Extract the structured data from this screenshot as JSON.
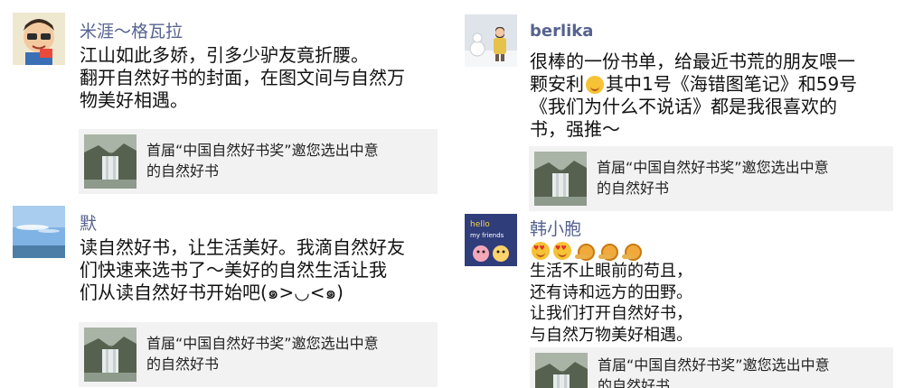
{
  "posts": [
    {
      "author": "米涯～格瓦拉",
      "lines": [
        "江山如此多娇，引多少驴友竟折腰。",
        "翻开自然好书的封面，在图文间与自然万",
        "物美好相遇。"
      ],
      "card": {
        "line1": "首届“中国自然好书奖”邀您选出中意",
        "line2": "的自然好书"
      }
    },
    {
      "author": "默",
      "lines": [
        "读自然好书，让生活美好。我滴自然好友",
        "们快速来选书了～美好的自然生活让我",
        "们从读自然好书开始吧(๑>◡<๑)"
      ],
      "card": {
        "line1": "首届“中国自然好书奖”邀您选出中意",
        "line2": "的自然好书"
      }
    },
    {
      "author": "berlika",
      "lines": [
        "很棒的一份书单，给最近书荒的朋友喂一",
        "颗安利",
        "其中1号《海错图笔记》和59号",
        "《我们为什么不说话》都是我很喜欢的",
        "书，强推～"
      ],
      "card": {
        "line1": "首届“中国自然好书奖”邀您选出中意",
        "line2": "的自然好书"
      }
    },
    {
      "author": "韩小胞",
      "emojis": [
        "love-heart-eyes-emoji",
        "love-heart-eyes-emoji",
        "snail-emoji",
        "snail-emoji",
        "snail-emoji"
      ],
      "avatar_text": {
        "l1": "hello",
        "l2": "my friends"
      },
      "lines": [
        "生活不止眼前的苟且，",
        "还有诗和远方的田野。",
        "让我们打开自然好书，",
        "与自然万物美好相遇。"
      ],
      "card": {
        "line1": "首届“中国自然好书奖”邀您选出中意",
        "line2": "的自然好书"
      }
    }
  ],
  "colors": {
    "name": "#56638f",
    "card_bg": "#f2f2f2",
    "text": "#111111"
  }
}
